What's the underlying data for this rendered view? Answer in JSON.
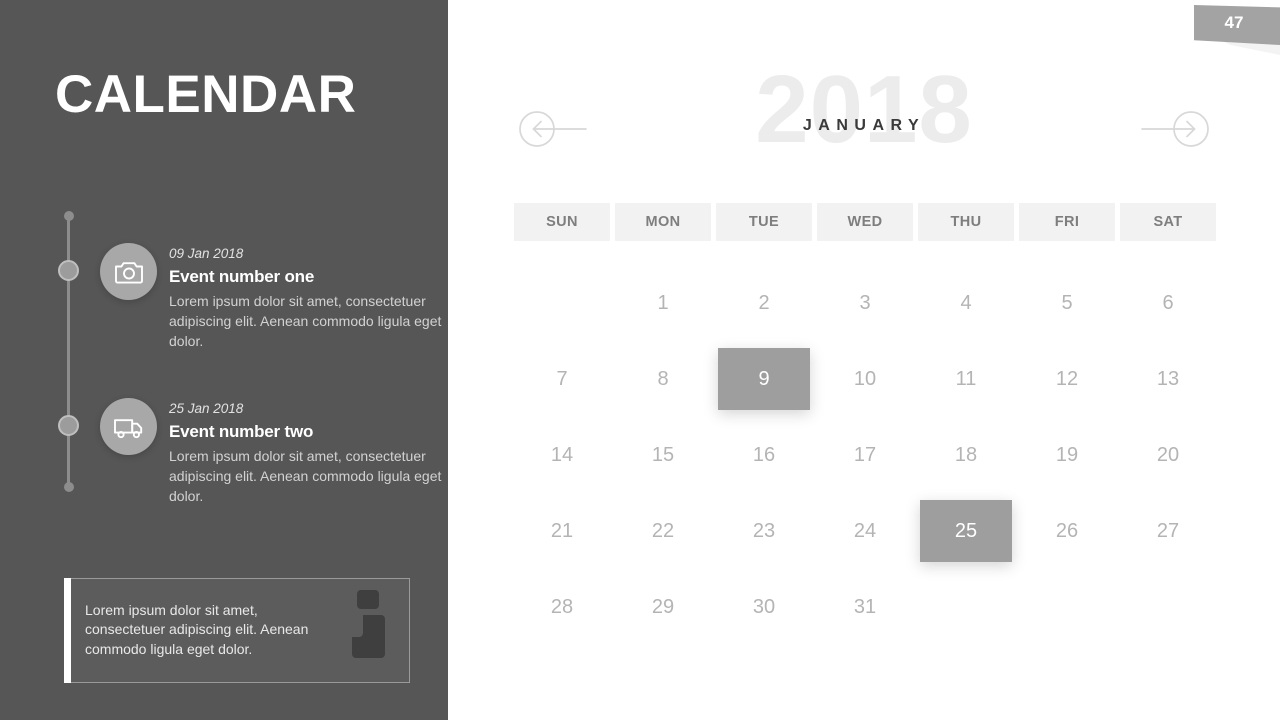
{
  "slide": {
    "page_number": "47",
    "title": "CALENDAR"
  },
  "sidebar": {
    "events": [
      {
        "date": "09 Jan 2018",
        "title": "Event number one",
        "description": "Lorem ipsum dolor sit amet, consectetuer adipiscing elit. Aenean commodo  ligula eget dolor.",
        "icon": "camera-icon"
      },
      {
        "date": "25 Jan 2018",
        "title": "Event number two",
        "description": "Lorem ipsum dolor sit amet, consectetuer adipiscing elit. Aenean commodo  ligula eget dolor.",
        "icon": "delivery-truck-icon"
      }
    ],
    "info_box": {
      "text": "Lorem ipsum dolor sit amet, consectetuer adipiscing elit. Aenean commodo ligula eget dolor.",
      "icon": "information-icon"
    }
  },
  "calendar": {
    "year": "2018",
    "month": "JANUARY",
    "prev_label": "previous-month",
    "next_label": "next-month",
    "weekday_headers": [
      "SUN",
      "MON",
      "TUE",
      "WED",
      "THU",
      "FRI",
      "SAT"
    ],
    "weeks": [
      [
        "",
        "1",
        "2",
        "3",
        "4",
        "5",
        "6"
      ],
      [
        "7",
        "8",
        "9",
        "10",
        "11",
        "12",
        "13"
      ],
      [
        "14",
        "15",
        "16",
        "17",
        "18",
        "19",
        "20"
      ],
      [
        "21",
        "22",
        "23",
        "24",
        "25",
        "26",
        "27"
      ],
      [
        "28",
        "29",
        "30",
        "31",
        "",
        "",
        ""
      ]
    ],
    "highlighted_days": [
      "9",
      "25"
    ],
    "colors": {
      "sidebar_bg": "#565656",
      "highlight_bg": "#9e9e9e",
      "header_cell_bg": "#f2f2f2",
      "year_watermark": "#ececec",
      "month_text": "#3a3a3a",
      "badge_bg": "#a3a3a3"
    }
  }
}
